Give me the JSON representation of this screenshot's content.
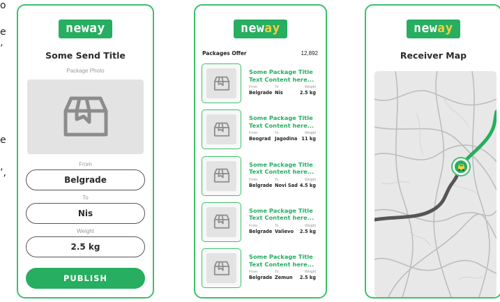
{
  "cut_text": [
    "o",
    "e",
    "’",
    "e",
    "’,"
  ],
  "brand": {
    "logo_main": "new",
    "logo_accent": "ay",
    "logo_full": "neway",
    "color": "#27ae60",
    "accent": "#f4d03f"
  },
  "send": {
    "title": "Some Send Title",
    "photo_label": "Package Photo",
    "from_label": "From",
    "from_value": "Belgrade",
    "to_label": "To",
    "to_value": "Nis",
    "weight_label": "Weight",
    "weight_value": "2.5 kg",
    "publish_label": "PUBLISH"
  },
  "offers": {
    "title": "Packages Offer",
    "count": "12,892",
    "col_from": "From",
    "col_to": "To",
    "col_weight": "Weight",
    "items": [
      {
        "title": "Some Package Title Text Content here...",
        "from": "Belgrade",
        "to": "Nis",
        "weight": "2.5 kg"
      },
      {
        "title": "Some Package Title Text Content here...",
        "from": "Beograd",
        "to": "Jagodina",
        "weight": "11 kg"
      },
      {
        "title": "Some Package Title Text Content here...",
        "from": "Belgrade",
        "to": "Novi Sad",
        "weight": "4.5 kg"
      },
      {
        "title": "Some Package Title Text Content here...",
        "from": "Belgrade",
        "to": "Valievo",
        "weight": "2.5 kg"
      },
      {
        "title": "Some Package Title Text Content here...",
        "from": "Belgrade",
        "to": "Zemun",
        "weight": "2.5 kg"
      }
    ]
  },
  "map": {
    "title": "Receiver Map",
    "marker_icon": "car-icon",
    "route_done_color": "#555555",
    "route_todo_color": "#27ae60"
  }
}
